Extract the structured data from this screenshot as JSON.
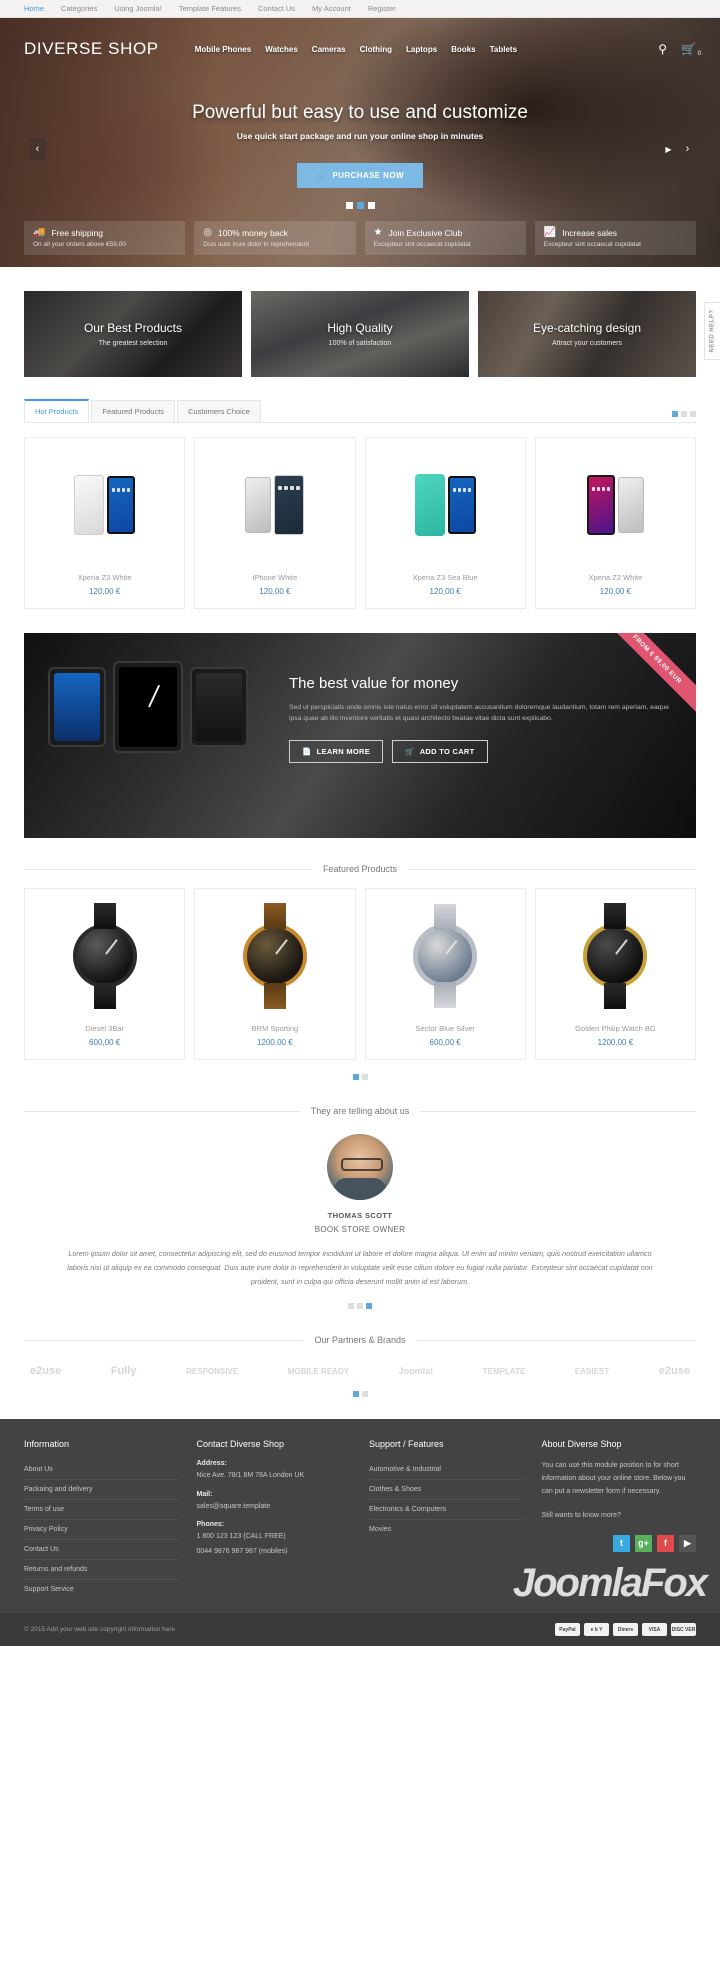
{
  "topbar": {
    "links": [
      "Home",
      "Categories",
      "Using Joomla!",
      "Template Features",
      "Contact Us",
      "My Account",
      "Register"
    ]
  },
  "header": {
    "logo": "DIVERSE SHOP",
    "nav": [
      "Mobile Phones",
      "Watches",
      "Cameras",
      "Clothing",
      "Laptops",
      "Books",
      "Tablets"
    ],
    "search_icon": "search-icon",
    "cart_icon": "cart-icon",
    "cart_count": "0"
  },
  "hero": {
    "title": "Powerful but easy to use and customize",
    "subtitle": "Use quick start package and run your online shop in minutes",
    "cta": "PURCHASE NOW",
    "prev_icon": "chevron-left-icon",
    "play_icon": "play-icon",
    "next_icon": "chevron-right-icon",
    "slides": 3,
    "active_slide": 2
  },
  "benefits": [
    {
      "icon": "truck-icon",
      "glyph": "Ὡa",
      "title": "Free shipping",
      "sub": "On all your orders above €59,00"
    },
    {
      "icon": "money-back-icon",
      "glyph": "◎",
      "title": "100% money back",
      "sub": "Duis aute irure dolor in reprehenderit"
    },
    {
      "icon": "star-icon",
      "glyph": "★",
      "title": "Join Exclusive Club",
      "sub": "Excepteur sint occaecat cupidatat"
    },
    {
      "icon": "chart-icon",
      "glyph": "↗",
      "title": "Increase sales",
      "sub": "Excepteur sint occaecat cupidatat"
    }
  ],
  "promos": [
    {
      "title": "Our Best Products",
      "sub": "The greatest selection"
    },
    {
      "title": "High Quality",
      "sub": "100% of satisfaction"
    },
    {
      "title": "Eye-catching design",
      "sub": "Attract your customers"
    }
  ],
  "need_help": "NEED HELP?",
  "tabs": [
    {
      "label": "Hot Products",
      "active": true
    },
    {
      "label": "Featured Products",
      "active": false
    },
    {
      "label": "Customers Choice",
      "active": false
    }
  ],
  "hot_products": [
    {
      "name": "Xperia Z3 White",
      "price": "120,00 €"
    },
    {
      "name": "iPhone White",
      "price": "120,00 €"
    },
    {
      "name": "Xperia Z3 Sea Blue",
      "price": "120,00 €"
    },
    {
      "name": "Xperia Z2 White",
      "price": "120,00 €"
    }
  ],
  "banner": {
    "ribbon": "FROM € 99,00 EUR",
    "title": "The best value for money",
    "text": "Sed ut perspiciatis unde omnis iste natus error sit voluptatem accusantium doloremque laudantium, totam rem aperiam, eaque ipsa quae ab illo inventore veritatis et quasi architecto beatae vitae dicta sunt explicabo.",
    "btn_learn": "LEARN MORE",
    "btn_cart": "ADD TO CART",
    "learn_icon": "document-icon",
    "cart_icon": "cart-icon"
  },
  "featured": {
    "title": "Featured Products",
    "products": [
      {
        "name": "Diesel 3Bar",
        "price": "600,00 €"
      },
      {
        "name": "BRM Sporting",
        "price": "1200,00 €"
      },
      {
        "name": "Sector Blue Silver",
        "price": "600,00 €"
      },
      {
        "name": "Golden Philip Watch BG",
        "price": "1200,00 €"
      }
    ],
    "pages": 2,
    "active_page": 1
  },
  "testimonials": {
    "title": "They are telling about us",
    "name": "THOMAS SCOTT",
    "role": "BOOK STORE OWNER",
    "quote": "Lorem ipsum dolor sit amet, consectetur adipiscing elit, sed do eiusmod tempor incididunt ut labore et dolore magna aliqua. Ut enim ad minim veniam, quis nostrud exercitation ullamco laboris nisi ut aliquip ex ea commodo consequat. Duis aute irure dolor in reprehenderit in voluptate velit esse cillum dolore eu fugiat nulla pariatur. Excepteur sint occaecat cupidatat non proident, sunt in culpa qui officia deserunt mollit anim id est laborum.",
    "pages": 3,
    "active_page": 3
  },
  "partners": {
    "title": "Our Partners & Brands",
    "logos": [
      "e2use",
      "Fully",
      "RESPONSIVE",
      "MOBILE READY",
      "Joomla!",
      "TEMPLATE",
      "EASIEST",
      "e2use"
    ],
    "pages": 2,
    "active_page": 1
  },
  "footer": {
    "information": {
      "heading": "Information",
      "links": [
        "About Us",
        "Packaing and delivery",
        "Terms of use",
        "Privacy Policy",
        "Contact Us",
        "Returns and refunds",
        "Support Service"
      ]
    },
    "contact": {
      "heading": "Contact Diverse Shop",
      "address_label": "Address:",
      "address": "Nice Ave. 78/1 6M 78A London UK",
      "mail_label": "Mail:",
      "mail": "sales@square.template",
      "phones_label": "Phones:",
      "phone1": "1 800 123 123 (CALL FREE)",
      "phone2": "0044 9876 987 987 (mobiles)"
    },
    "support": {
      "heading": "Support / Features",
      "links": [
        "Automotive & Industrial",
        "Clothes & Shoes",
        "Electronics & Computers",
        "Movies"
      ]
    },
    "about": {
      "heading": "About Diverse Shop",
      "text": "You can use this module position to for short information about your online store. Below you can put a newsletter form if necessary.",
      "more": "Still wants to know more?"
    },
    "socials": [
      {
        "name": "twitter-icon",
        "glyph": "t",
        "color": "#3aa9e0"
      },
      {
        "name": "google-plus-icon",
        "glyph": "g+",
        "color": "#57b05a"
      },
      {
        "name": "facebook-icon",
        "glyph": "f",
        "color": "#e04a4a"
      },
      {
        "name": "youtube-icon",
        "glyph": "▶",
        "color": "#555555"
      }
    ],
    "copyright": "© 2015 Add your web site copyright information here",
    "payments": [
      "PayPal",
      "e b Y",
      "Diners",
      "VISA",
      "DISC VER"
    ],
    "watermark": "JoomlaFox"
  },
  "colors": {
    "accent": "#3d9be9",
    "cta": "#7cb9e4",
    "ribbon": "#e0556f",
    "footer_bg": "#434343",
    "price": "#3d7fb5"
  }
}
